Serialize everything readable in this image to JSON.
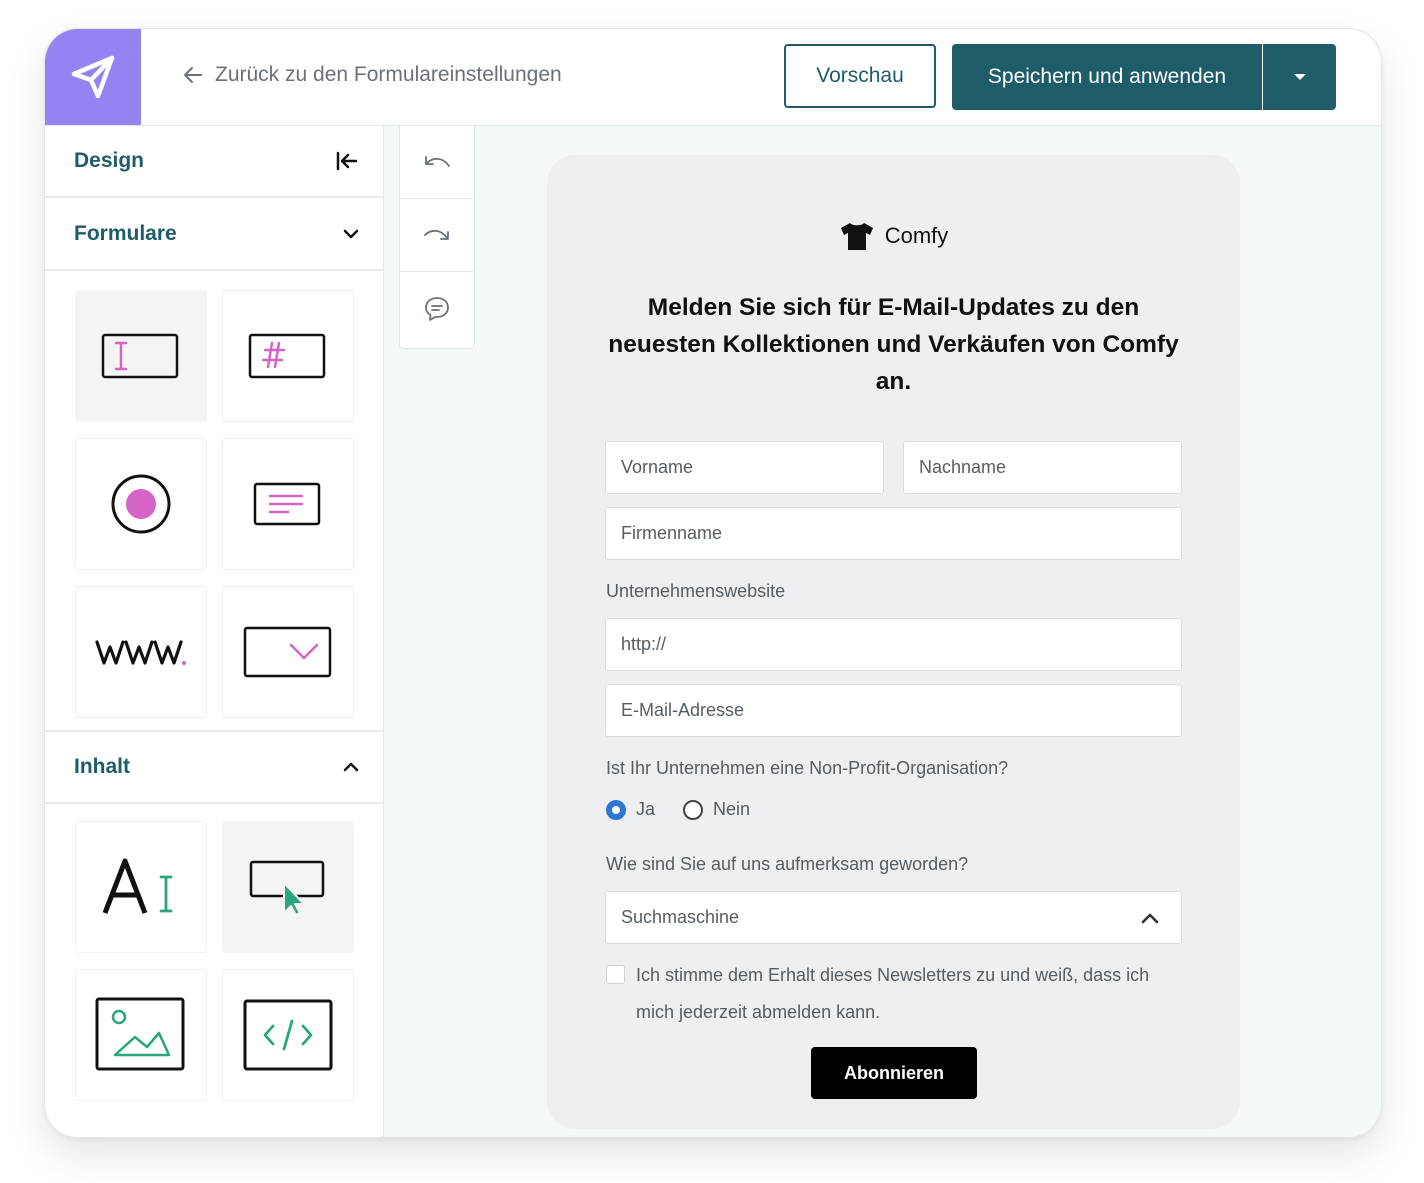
{
  "header": {
    "back_label": "Zurück zu den Formulareinstellungen",
    "preview_label": "Vorschau",
    "save_label": "Speichern und anwenden"
  },
  "sidebar": {
    "design_label": "Design",
    "forms_label": "Formulare",
    "content_label": "Inhalt",
    "form_tiles": [
      "text-input-field",
      "number-field",
      "radio-button",
      "text-area",
      "url-field",
      "dropdown-field"
    ],
    "content_tiles": [
      "text-block",
      "button-block",
      "image-block",
      "html-block"
    ]
  },
  "toolbar": {
    "tools": [
      "undo",
      "redo",
      "comments"
    ]
  },
  "form": {
    "brand_name": "Comfy",
    "title": "Melden Sie sich für E-Mail-Updates zu den neuesten Kollektionen und Verkäufen von Comfy an.",
    "first_name_placeholder": "Vorname",
    "last_name_placeholder": "Nachname",
    "company_placeholder": "Firmenname",
    "website_label": "Unternehmenswebsite",
    "website_value": "http://",
    "email_placeholder": "E-Mail-Adresse",
    "nonprofit_question": "Ist Ihr Unternehmen eine Non-Profit-Organisation?",
    "radio_yes": "Ja",
    "radio_no": "Nein",
    "radio_selected": "Ja",
    "source_question": "Wie sind Sie auf uns aufmerksam geworden?",
    "source_selected": "Suchmaschine",
    "consent_text": "Ich stimme dem Erhalt dieses Newsletters zu und weiß, dass ich mich jederzeit abmelden kann.",
    "consent_checked": false,
    "submit_label": "Abonnieren"
  },
  "colors": {
    "brand_purple": "#9583f2",
    "primary_teal": "#1e5c68",
    "accent_pink": "#d663c6",
    "accent_green": "#2aa67e",
    "radio_blue": "#2d78d6"
  }
}
